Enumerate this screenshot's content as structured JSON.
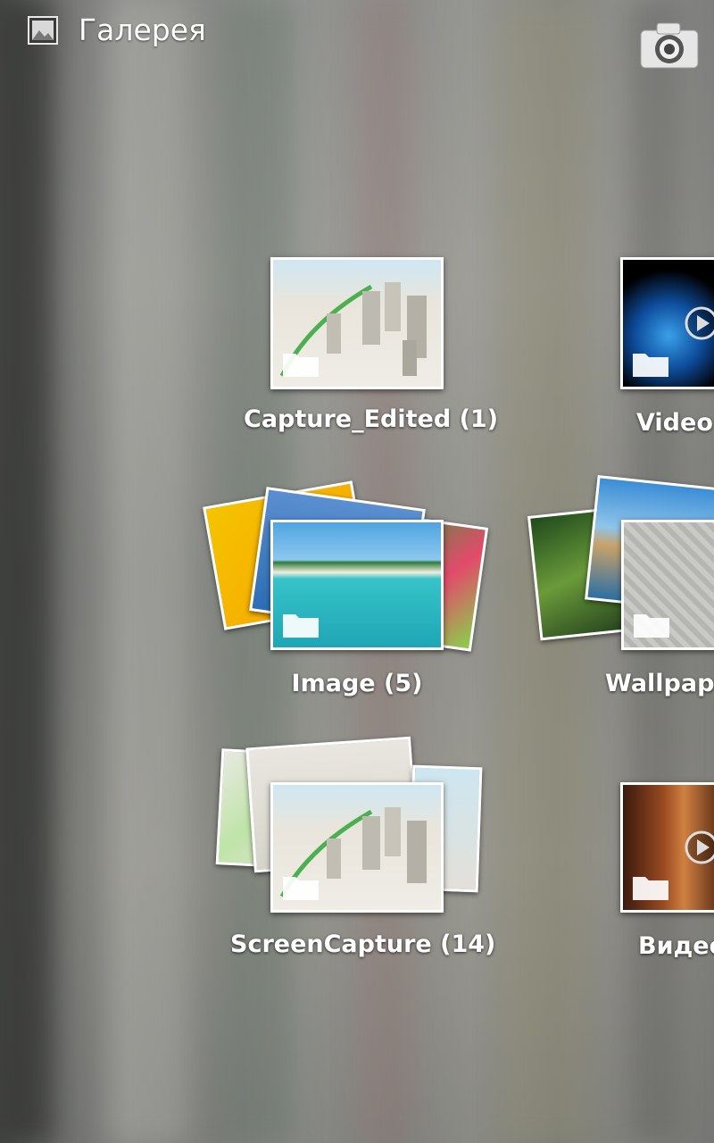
{
  "header": {
    "title": "Галерея",
    "app_icon": "picture-icon",
    "camera_icon": "camera-icon"
  },
  "albums": [
    {
      "name": "Capture_Edited",
      "count": "(1)",
      "type": "folder"
    },
    {
      "name": "Video",
      "count": "",
      "type": "video"
    },
    {
      "name": "Image",
      "count": "(5)",
      "type": "folder"
    },
    {
      "name": "Wallpap",
      "count": "",
      "type": "folder"
    },
    {
      "name": "ScreenCapture",
      "count": "(14)",
      "type": "folder"
    },
    {
      "name": "Видео",
      "count": "",
      "type": "video"
    }
  ],
  "labels": {
    "capture_edited": "Capture_Edited  (1)",
    "video": "Video",
    "image": "Image  (5)",
    "wallpaper": "Wallpap",
    "screencapture": "ScreenCapture  (14)",
    "video_ru": "Видео"
  },
  "colors": {
    "label_text": "#ffffff",
    "photo_border": "#ffffff"
  }
}
